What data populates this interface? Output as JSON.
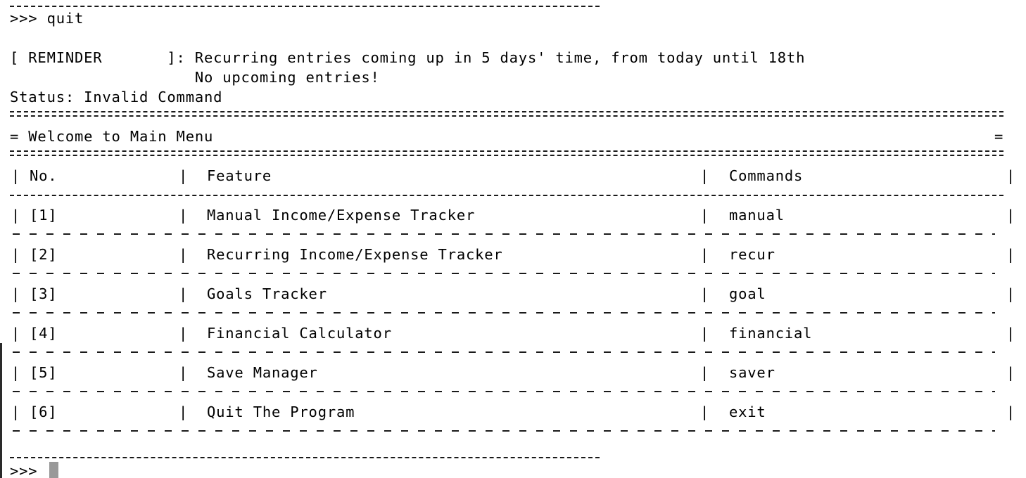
{
  "terminal": {
    "prompt": ">>>",
    "previous_command_line": ">>> quit",
    "reminder": {
      "tag_line": "[ REMINDER       ]: Recurring entries coming up in 5 days' time, from today until 18th",
      "detail_line": "                    No upcoming entries!"
    },
    "status_line": "Status: Invalid Command",
    "menu_title_line": "= Welcome to Main Menu",
    "menu_title_right_border": "=",
    "table": {
      "headers": {
        "no": "No.",
        "feature": "Feature",
        "commands": "Commands"
      },
      "rows": [
        {
          "no": "[1]",
          "feature": "Manual Income/Expense Tracker",
          "command": "manual"
        },
        {
          "no": "[2]",
          "feature": "Recurring Income/Expense Tracker",
          "command": "recur"
        },
        {
          "no": "[3]",
          "feature": "Goals Tracker",
          "command": "goal"
        },
        {
          "no": "[4]",
          "feature": "Financial Calculator",
          "command": "financial"
        },
        {
          "no": "[5]",
          "feature": "Save Manager",
          "command": "saver"
        },
        {
          "no": "[6]",
          "feature": "Quit The Program",
          "command": "exit"
        }
      ]
    },
    "current_prompt": ">>>"
  }
}
